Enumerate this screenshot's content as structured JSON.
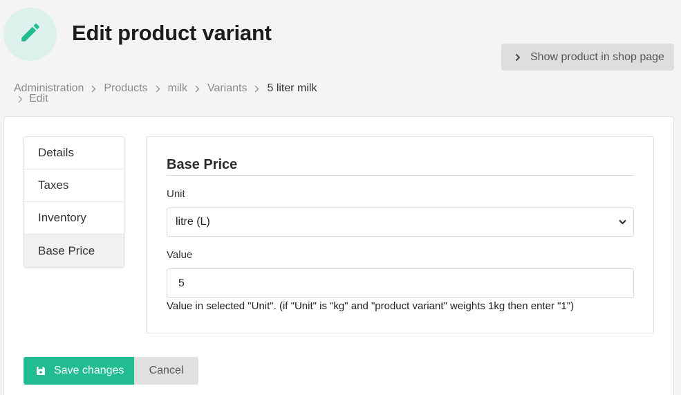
{
  "header": {
    "title": "Edit product variant",
    "icon": "pencil-icon",
    "icon_color": "#21bc92",
    "show_button_label": "Show product in shop page"
  },
  "breadcrumb": {
    "items": [
      "Administration",
      "Products",
      "milk",
      "Variants",
      "5 liter milk",
      "Edit"
    ]
  },
  "tabs": [
    {
      "label": "Details",
      "active": false
    },
    {
      "label": "Taxes",
      "active": false
    },
    {
      "label": "Inventory",
      "active": false
    },
    {
      "label": "Base Price",
      "active": true
    }
  ],
  "base_price": {
    "section_title": "Base Price",
    "unit_label": "Unit",
    "unit_value": "litre (L)",
    "value_label": "Value",
    "value": "5",
    "help_text": "Value in selected \"Unit\". (if \"Unit\" is \"kg\" and \"product variant\" weights 1kg then enter \"1\")"
  },
  "actions": {
    "save_label": "Save changes",
    "cancel_label": "Cancel"
  },
  "colors": {
    "accent": "#21bc92",
    "icon_bg": "#dcf1ec"
  }
}
